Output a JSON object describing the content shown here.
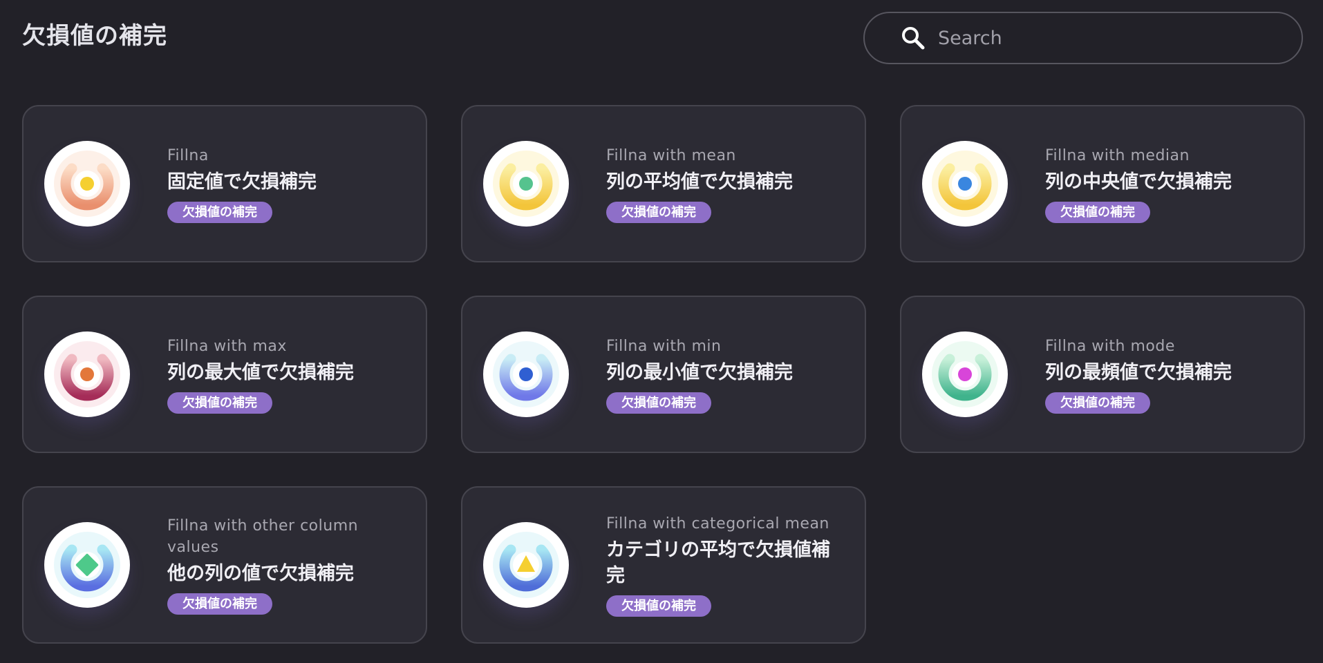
{
  "header": {
    "title": "欠損値の補完"
  },
  "search": {
    "placeholder": "Search",
    "icon": "search-icon"
  },
  "cards": [
    {
      "subtitle": "Fillna",
      "title": "固定値で欠損補完",
      "tag": "欠損値の補完",
      "icon": "ring-dot-icon",
      "colors": {
        "ring_top": "#fcdcc6",
        "ring_bottom": "#e98f6d",
        "center": "#f5cf30",
        "glow": "#fbe3d6"
      }
    },
    {
      "subtitle": "Fillna with mean",
      "title": "列の平均値で欠損補完",
      "tag": "欠損値の補完",
      "icon": "ring-dot-icon",
      "colors": {
        "ring_top": "#fbeea0",
        "ring_bottom": "#f3c53a",
        "center": "#55c38e",
        "glow": "#fdf3c5"
      }
    },
    {
      "subtitle": "Fillna with median",
      "title": "列の中央値で欠損補完",
      "tag": "欠損値の補完",
      "icon": "ring-dot-icon",
      "colors": {
        "ring_top": "#fbeea0",
        "ring_bottom": "#f3c53a",
        "center": "#3a86df",
        "glow": "#fdf3c5"
      }
    },
    {
      "subtitle": "Fillna with max",
      "title": "列の最大値で欠損補完",
      "tag": "欠損値の補完",
      "icon": "ring-dot-icon",
      "colors": {
        "ring_top": "#f0b9c1",
        "ring_bottom": "#a52c58",
        "center": "#e3773a",
        "glow": "#f7dbe0"
      }
    },
    {
      "subtitle": "Fillna with min",
      "title": "列の最小値で欠損補完",
      "tag": "欠損値の補完",
      "icon": "ring-dot-icon",
      "colors": {
        "ring_top": "#c8ecf5",
        "ring_bottom": "#6f78e8",
        "center": "#2f5fd2",
        "glow": "#dcf3f8"
      }
    },
    {
      "subtitle": "Fillna with mode",
      "title": "列の最頻値で欠損補完",
      "tag": "欠損値の補完",
      "icon": "ring-dot-icon",
      "colors": {
        "ring_top": "#c7f0d9",
        "ring_bottom": "#3fb38c",
        "center": "#d845d9",
        "glow": "#dcf6e8"
      }
    },
    {
      "subtitle": "Fillna with other column values",
      "title": "他の列の値で欠損補完",
      "tag": "欠損値の補完",
      "icon": "ring-diamond-icon",
      "colors": {
        "ring_top": "#a7e6f3",
        "ring_bottom": "#5a6ee0",
        "center": "#4ec98a",
        "glow": "#d7f2f8"
      }
    },
    {
      "subtitle": "Fillna with categorical mean",
      "title": "カテゴリの平均で欠損値補完",
      "tag": "欠損値の補完",
      "icon": "ring-triangle-icon",
      "colors": {
        "ring_top": "#a7e6f3",
        "ring_bottom": "#4f6dd8",
        "center": "#f5cf30",
        "glow": "#d7f2f8"
      }
    }
  ]
}
